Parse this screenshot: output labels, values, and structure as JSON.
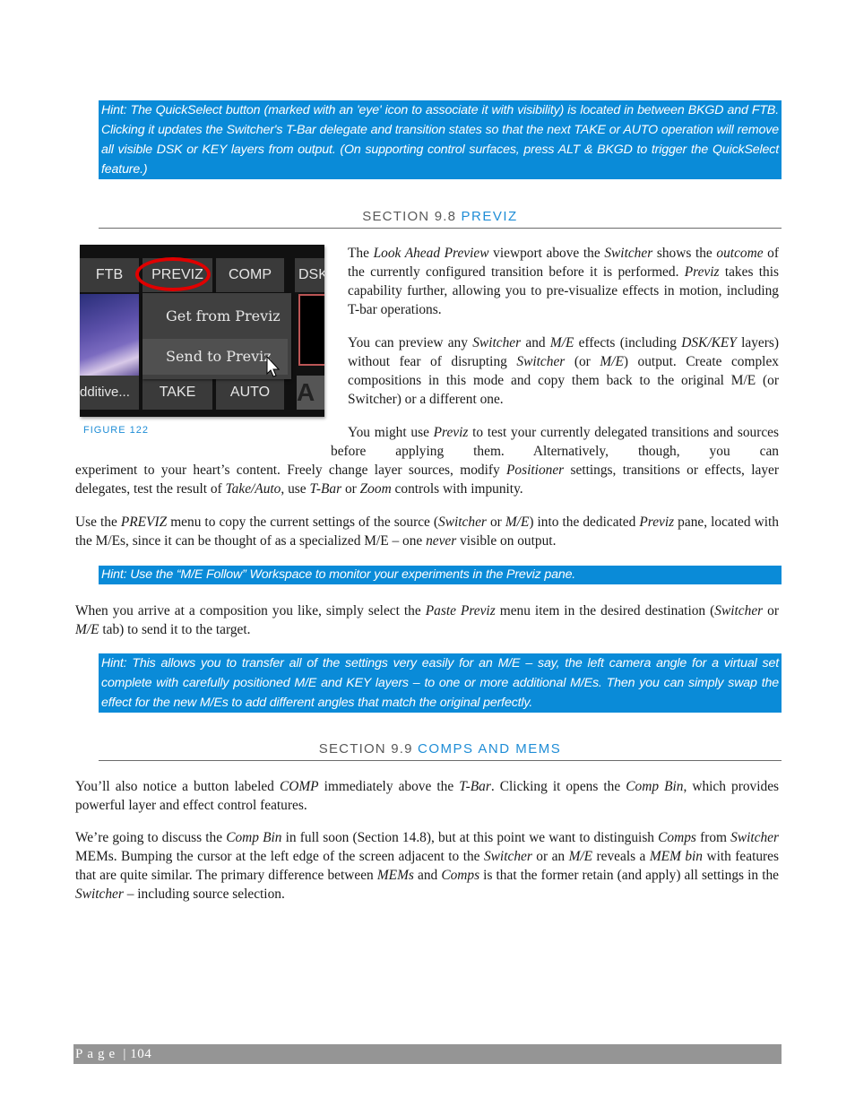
{
  "hint_quickselect": "Hint:  The QuickSelect button (marked with an 'eye' icon to associate it with visibility) is located in between BKGD and FTB. Clicking it updates the Switcher's T-Bar delegate and transition states so that the next TAKE or AUTO operation will remove all visible DSK or KEY layers from output. (On supporting control surfaces, press ALT & BKGD to trigger the QuickSelect feature.)",
  "section_98": {
    "prefix": "SECTION 9.8 ",
    "name": "PREVIZ"
  },
  "figure": {
    "caption": "FIGURE 122",
    "buttons_top": [
      "FTB",
      "PREVIZ",
      "COMP",
      "DSK"
    ],
    "buttons_bottom": [
      "dditive...",
      "TAKE",
      "AUTO",
      "A"
    ],
    "menu_items": [
      "Get from Previz",
      "Send to Previz"
    ],
    "highlight_color": "#e00000"
  },
  "p1": {
    "a": "The ",
    "b": "Look Ahead Preview",
    "c": " viewport above the ",
    "d": "Switcher",
    "e": " shows the ",
    "f": "outcome",
    "g": " of the currently configured transition before it is performed.  ",
    "h": "Previz",
    "i": " takes this capability further, allowing you to pre-visualize effects in motion, including T-bar operations."
  },
  "p2": {
    "a": "You can preview any ",
    "b": "Switcher",
    "c": " and ",
    "d": "M/E",
    "e": " effects (including ",
    "f": "DSK/KEY",
    "g": " layers) without fear of disrupting ",
    "h": "Switcher",
    "i": " (or ",
    "j": "M/E",
    "k": ") output.  Create complex compositions in this mode and copy them back to the original M/E (or Switcher) or a different one."
  },
  "p3": {
    "a": "You might use ",
    "b": "Previz",
    "c": " to test your currently delegated transitions and sources before applying them.  Alternatively, though, you can",
    "d": "experiment to your heart’s content.  Freely change layer sources, modify ",
    "e": "Positioner",
    "f": " settings, transitions or effects, layer delegates, test the result of ",
    "g": "Take/Auto",
    "h": ", use ",
    "i": "T-Bar",
    "j": " or ",
    "k": "Zoom",
    "l": " controls with impunity."
  },
  "p4": {
    "a": "Use the ",
    "b": "PREVIZ",
    "c": " menu to copy the current settings of the source (",
    "d": "Switcher",
    "e": " or ",
    "f": "M/E",
    "g": ") into the dedicated ",
    "h": "Previz",
    "i": " pane, located with the M/Es, since it can be thought of as a specialized M/E – one ",
    "j": "never",
    "k": " visible on output."
  },
  "hint_follow": "Hint: Use the “M/E Follow” Workspace to monitor your experiments in the Previz pane.",
  "p5": {
    "a": "When you arrive at a composition you like, simply select the ",
    "b": "Paste Previz",
    "c": " menu item in the desired destination (",
    "d": "Switcher",
    "e": " or ",
    "f": "M/E",
    "g": " tab) to send it to the target."
  },
  "hint_transfer": "Hint: This allows you to transfer all of the settings very easily for an M/E – say, the left camera angle for a virtual set complete with carefully positioned M/E and KEY layers – to one or more additional M/Es.  Then you can simply swap the effect for the new M/Es to add different angles that match the original perfectly.",
  "section_99": {
    "prefix": "SECTION 9.9 ",
    "name": "COMPS AND MEMS"
  },
  "p6": {
    "a": "You’ll also notice a button labeled ",
    "b": "COMP",
    "c": " immediately above the ",
    "d": "T-Bar",
    "e": ".  Clicking it opens the ",
    "f": "Comp Bin",
    "g": ", which provides powerful layer and effect control features."
  },
  "p7": {
    "a": "We’re going to discuss the ",
    "b": "Comp Bin",
    "c": " in full soon (Section 14.8), but at this point we want to distinguish ",
    "d": "Comps",
    "e": " from ",
    "f": "Switcher",
    "g": " MEMs. Bumping the cursor at the left edge of the screen adjacent to the ",
    "h": "Switcher",
    "i": " or an ",
    "j": "M/E",
    "k": " reveals a ",
    "l": "MEM bin",
    "m": " with features that are quite similar.  The primary difference between ",
    "n": "MEMs",
    "o": " and ",
    "p": "Comps",
    "q": " is that the former retain (and apply) all settings in the ",
    "r": "Switcher",
    "s": " – including source selection."
  },
  "footer": {
    "page_label": "Page",
    "separator": " | ",
    "page_number": "104"
  }
}
